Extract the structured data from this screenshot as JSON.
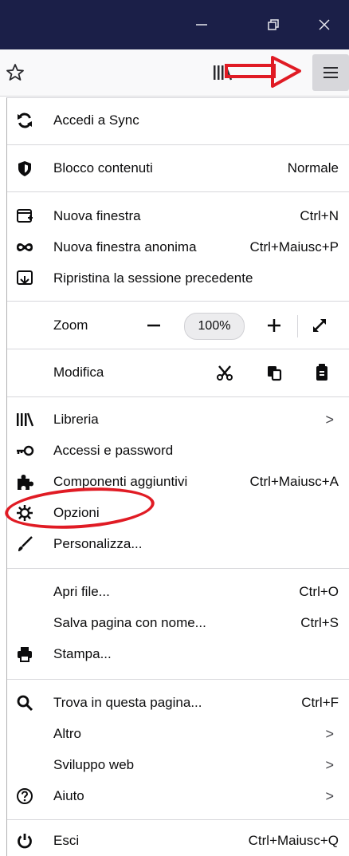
{
  "window": {
    "minimize_icon": "minimize-icon",
    "restore_icon": "restore-icon",
    "close_icon": "close-icon"
  },
  "toolbar": {
    "bookmark_icon": "star-icon",
    "library_icon": "library-icon",
    "menu_icon": "hamburger-menu-icon",
    "annotation_color": "#e01b24"
  },
  "menu": {
    "sync": {
      "label": "Accedi a Sync"
    },
    "content_blocking": {
      "label": "Blocco contenuti",
      "value": "Normale"
    },
    "new_window": {
      "label": "Nuova finestra",
      "shortcut": "Ctrl+N"
    },
    "private_window": {
      "label": "Nuova finestra anonima",
      "shortcut": "Ctrl+Maiusc+P"
    },
    "restore_session": {
      "label": "Ripristina la sessione precedente"
    },
    "zoom": {
      "label": "Zoom",
      "value": "100%"
    },
    "edit": {
      "label": "Modifica"
    },
    "library": {
      "label": "Libreria",
      "chevron": ">"
    },
    "logins": {
      "label": "Accessi e password"
    },
    "addons": {
      "label": "Componenti aggiuntivi",
      "shortcut": "Ctrl+Maiusc+A"
    },
    "options": {
      "label": "Opzioni"
    },
    "customize": {
      "label": "Personalizza..."
    },
    "open_file": {
      "label": "Apri file...",
      "shortcut": "Ctrl+O"
    },
    "save_page": {
      "label": "Salva pagina con nome...",
      "shortcut": "Ctrl+S"
    },
    "print": {
      "label": "Stampa..."
    },
    "find": {
      "label": "Trova in questa pagina...",
      "shortcut": "Ctrl+F"
    },
    "more": {
      "label": "Altro",
      "chevron": ">"
    },
    "web_dev": {
      "label": "Sviluppo web",
      "chevron": ">"
    },
    "help": {
      "label": "Aiuto",
      "chevron": ">"
    },
    "quit": {
      "label": "Esci",
      "shortcut": "Ctrl+Maiusc+Q"
    }
  }
}
